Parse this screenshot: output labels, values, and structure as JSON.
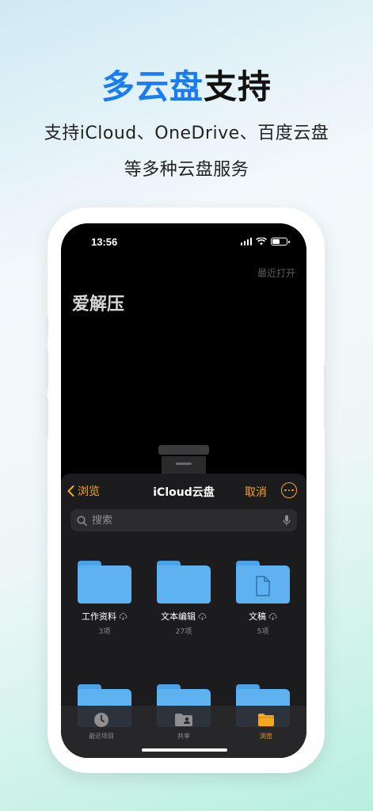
{
  "hero": {
    "title_accent": "多云盘",
    "title_rest": "支持",
    "subtitle_line1": "支持iCloud、OneDrive、百度云盘",
    "subtitle_line2": "等多种云盘服务",
    "accent_color": "#1a7cf0"
  },
  "status_bar": {
    "time": "13:56",
    "icons": [
      "cellular-signal-icon",
      "wifi-icon",
      "battery-icon"
    ]
  },
  "app": {
    "recent_open_label": "最近打开",
    "title": "爱解压"
  },
  "picker": {
    "back_label": "浏览",
    "title": "iCloud云盘",
    "cancel_label": "取消",
    "accent_color": "#f5a623",
    "search_placeholder": "搜索",
    "folders": [
      {
        "name": "工作资料",
        "count": "3项",
        "icon": "folder-icon"
      },
      {
        "name": "文本编辑",
        "count": "27项",
        "icon": "folder-icon"
      },
      {
        "name": "文稿",
        "count": "5项",
        "icon": "documents-folder-icon"
      }
    ],
    "tabs": [
      {
        "label": "最近项目",
        "icon": "clock-icon",
        "active": false
      },
      {
        "label": "共享",
        "icon": "shared-folder-icon",
        "active": false
      },
      {
        "label": "浏览",
        "icon": "folder-icon",
        "active": true
      }
    ]
  }
}
